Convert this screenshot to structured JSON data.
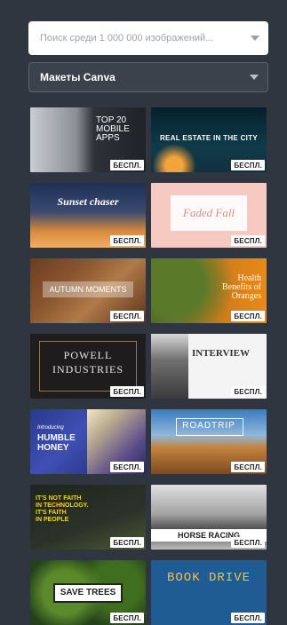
{
  "search": {
    "placeholder": "Поиск среди 1 000 000 изображений..."
  },
  "filter": {
    "value": "Макеты Canva"
  },
  "badge_label": "БЕСПЛ.",
  "templates": [
    {
      "lines": [
        "TOP 20",
        "MOBILE",
        "APPS"
      ]
    },
    {
      "lines": [
        "REAL ESTATE IN THE CITY"
      ]
    },
    {
      "lines": [
        "Sunset chaser"
      ]
    },
    {
      "lines": [
        "Faded Fall"
      ]
    },
    {
      "lines": [
        "AUTUMN MOMENTS"
      ]
    },
    {
      "lines": [
        "Health",
        "Benefits of",
        "Oranges"
      ]
    },
    {
      "lines": [
        "POWELL",
        "INDUSTRIES"
      ]
    },
    {
      "lines": [
        "INTERVIEW"
      ]
    },
    {
      "lines": [
        "Introducing",
        "HUMBLE",
        "HONEY"
      ]
    },
    {
      "lines": [
        "ROADTRIP"
      ]
    },
    {
      "lines": [
        "IT'S NOT FAITH",
        "IN TECHNOLOGY.",
        "IT'S FAITH",
        "IN PEOPLE"
      ]
    },
    {
      "lines": [
        "HORSE RACING"
      ]
    },
    {
      "lines": [
        "SAVE TREES"
      ]
    },
    {
      "lines": [
        "BOOK DRIVE"
      ]
    }
  ]
}
